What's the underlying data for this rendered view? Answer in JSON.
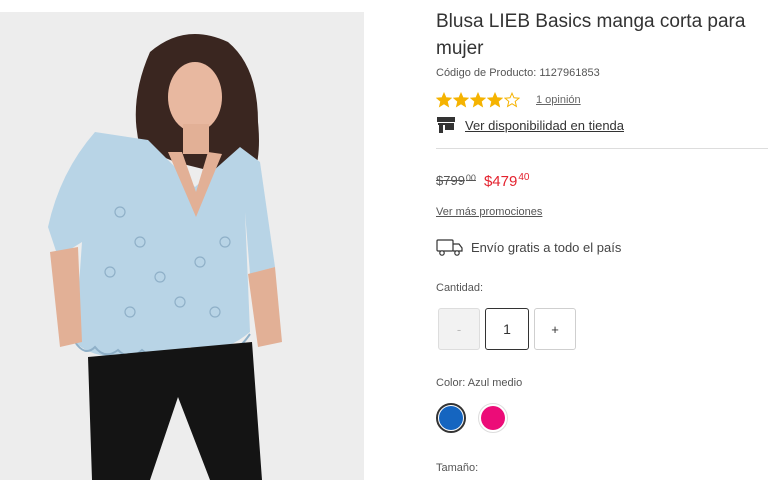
{
  "product": {
    "title": "Blusa LIEB Basics manga corta para mujer",
    "code_label": "Código de Producto: 1127961853",
    "image_icon": "model-wearing-light-blue-eyelet-blouse"
  },
  "rating": {
    "stars": 4,
    "max_stars": 5,
    "star_color": "#f5b301",
    "reviews_label": "1 opinión"
  },
  "availability": {
    "icon": "store-icon",
    "label": "Ver disponibilidad en tienda"
  },
  "price": {
    "old_main": "$799",
    "old_cents": "00",
    "new_main": "$479",
    "new_cents": "40",
    "sale_color": "#e4232f"
  },
  "promotions": {
    "label": "Ver más promociones"
  },
  "shipping": {
    "icon": "truck-icon",
    "label": "Envío gratis a todo el país"
  },
  "quantity": {
    "label": "Cantidad:",
    "minus": "-",
    "value": "1",
    "plus": "+"
  },
  "color": {
    "label": "Color: Azul medio",
    "options": [
      {
        "name": "Azul medio",
        "hex": "#1565c0",
        "selected": true
      },
      {
        "name": "Rosa",
        "hex": "#ec0c78",
        "selected": false
      }
    ]
  },
  "size": {
    "label": "Tamaño:"
  }
}
